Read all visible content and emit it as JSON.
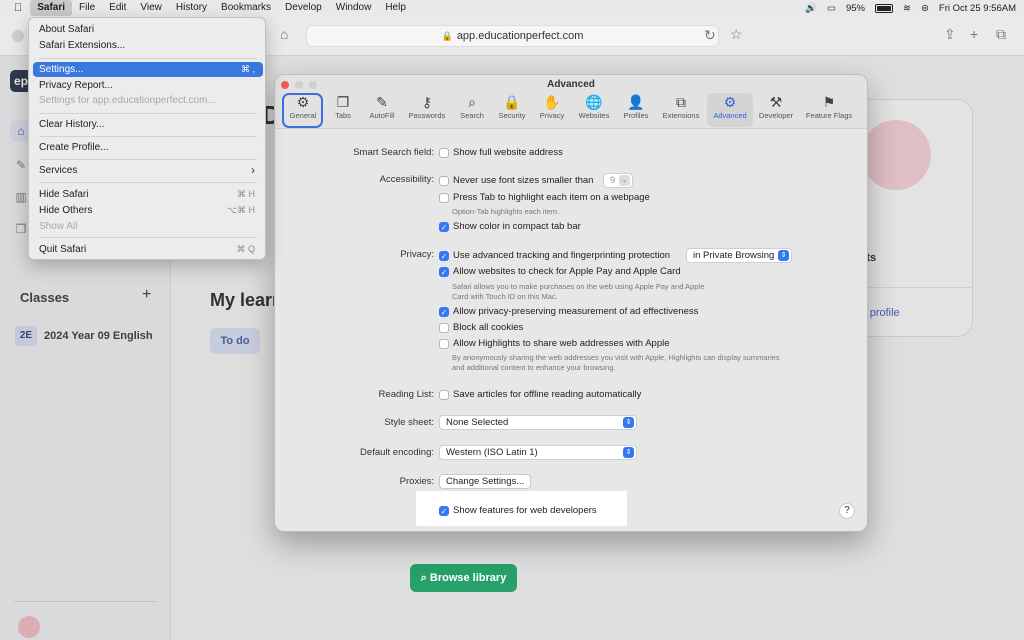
{
  "menubar": {
    "apple": "",
    "items": [
      "Safari",
      "File",
      "Edit",
      "View",
      "History",
      "Bookmarks",
      "Develop",
      "Window",
      "Help"
    ],
    "battery": "95%",
    "datetime": "Fri Oct 25  9:56AM"
  },
  "browser": {
    "url": "app.educationperfect.com"
  },
  "safari_menu": {
    "about": "About Safari",
    "extensions": "Safari Extensions...",
    "settings": "Settings...",
    "settings_shortcut": "⌘ ,",
    "privacy_report": "Privacy Report...",
    "settings_for_site": "Settings for app.educationperfect.com...",
    "clear_history": "Clear History...",
    "create_profile": "Create Profile...",
    "services": "Services",
    "services_arrow": "›",
    "hide_safari": "Hide Safari",
    "hide_safari_shortcut": "⌘ H",
    "hide_others": "Hide Others",
    "hide_others_shortcut": "⌥⌘ H",
    "show_all": "Show All",
    "quit": "Quit Safari",
    "quit_shortcut": "⌘ Q"
  },
  "page": {
    "logo": "ep",
    "title_peek": "D",
    "classes_label": "Classes",
    "classes_add": "+",
    "class_badge": "2E",
    "class_name": "2024 Year 09 English",
    "my_learning": "My learn",
    "todo": "To do",
    "card_pts": "Pts",
    "card_link": "r profile",
    "browse": "Browse library"
  },
  "prefs": {
    "title": "Advanced",
    "tabs": [
      {
        "label": "General",
        "glyph": "⚙"
      },
      {
        "label": "Tabs",
        "glyph": "❐"
      },
      {
        "label": "AutoFill",
        "glyph": "✎"
      },
      {
        "label": "Passwords",
        "glyph": "⚷"
      },
      {
        "label": "Search",
        "glyph": "⌕"
      },
      {
        "label": "Security",
        "glyph": "🔒"
      },
      {
        "label": "Privacy",
        "glyph": "✋"
      },
      {
        "label": "Websites",
        "glyph": "🌐"
      },
      {
        "label": "Profiles",
        "glyph": "👤"
      },
      {
        "label": "Extensions",
        "glyph": "⧉"
      },
      {
        "label": "Advanced",
        "glyph": "⚙"
      },
      {
        "label": "Developer",
        "glyph": "⚒"
      },
      {
        "label": "Feature Flags",
        "glyph": "⚑"
      }
    ],
    "smart_search_label": "Smart Search field:",
    "show_full_address": "Show full website address",
    "accessibility_label": "Accessibility:",
    "never_font": "Never use font sizes smaller than",
    "font_size": "9",
    "press_tab": "Press Tab to highlight each item on a webpage",
    "option_tab_note": "Option-Tab highlights each item.",
    "show_color": "Show color in compact tab bar",
    "privacy_label": "Privacy:",
    "advanced_tracking": "Use advanced tracking and fingerprinting protection",
    "tracking_mode": "in Private Browsing",
    "apple_pay": "Allow websites to check for Apple Pay and Apple Card",
    "apple_pay_note": "Safari allows you to make purchases on the web using Apple Pay and Apple Card with Touch ID on this Mac.",
    "privacy_ads": "Allow privacy-preserving measurement of ad effectiveness",
    "block_cookies": "Block all cookies",
    "highlights": "Allow Highlights to share web addresses with Apple",
    "highlights_note": "By anonymously sharing the web addresses you visit with Apple, Highlights can display summaries and additional content to enhance your browsing.",
    "reading_list_label": "Reading List:",
    "save_articles": "Save articles for offline reading automatically",
    "style_sheet_label": "Style sheet:",
    "style_sheet_value": "None Selected",
    "encoding_label": "Default encoding:",
    "encoding_value": "Western (ISO Latin 1)",
    "proxies_label": "Proxies:",
    "change_settings": "Change Settings...",
    "web_dev": "Show features for web developers",
    "help": "?"
  }
}
